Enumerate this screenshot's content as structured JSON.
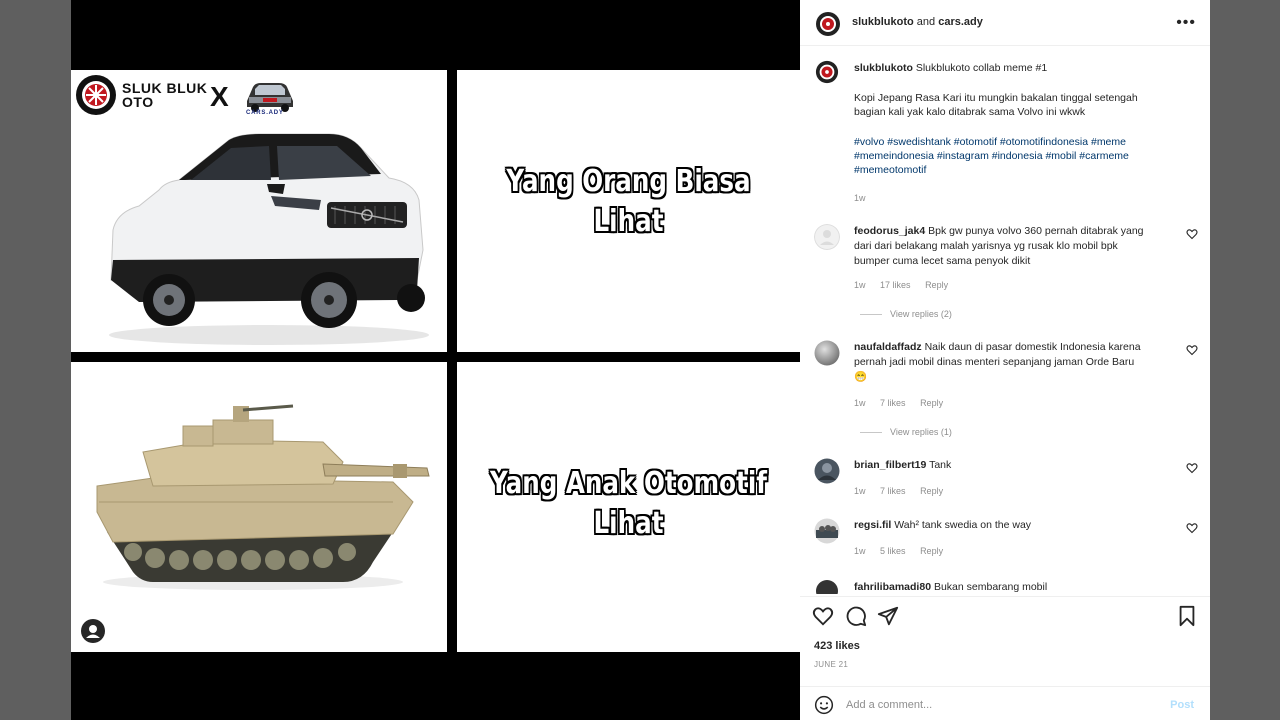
{
  "header": {
    "user1": "slukblukoto",
    "joiner": "and",
    "user2": "cars.ady",
    "more_icon": "more-horizontal-icon"
  },
  "meme": {
    "logo_text_line1": "SLUK BLUK",
    "logo_text_line2": "OTO",
    "collab_x": "X",
    "partner_logo_text": "CARS.ADY",
    "top_text_line1": "Yang Orang Biasa",
    "top_text_line2": "Lihat",
    "bottom_text_line1": "Yang Anak Otomotif",
    "bottom_text_line2": "Lihat"
  },
  "caption": {
    "username": "slukblukoto",
    "title": "Slukblukoto collab meme #1",
    "body_line1": "Kopi Jepang Rasa Kari itu mungkin bakalan tinggal setengah",
    "body_line2": "bagian kali yak kalo ditabrak sama Volvo ini wkwk",
    "tags_line1": "#volvo #swedishtank #otomotif #otomotifindonesia #meme",
    "tags_line2": "#memeindonesia #instagram #indonesia #mobil #carmeme",
    "tags_line3": "#memeotomotif",
    "time": "1w"
  },
  "comments": [
    {
      "username": "feodorus_jak4",
      "text_line1": "Bpk gw punya volvo 360 pernah ditabrak yang",
      "text_line2": "dari dari belakang malah yarisnya yg rusak klo mobil bpk",
      "text_line3": "bumper cuma lecet sama penyok dikit",
      "time": "1w",
      "likes": "17 likes",
      "reply": "Reply",
      "view_replies": "View replies (2)"
    },
    {
      "username": "naufaldaffadz",
      "text_line1": "Naik daun di pasar domestik Indonesia karena",
      "text_line2": "pernah jadi mobil dinas menteri sepanjang jaman Orde Baru",
      "text_line3": "😁",
      "time": "1w",
      "likes": "7 likes",
      "reply": "Reply",
      "view_replies": "View replies (1)"
    },
    {
      "username": "brian_filbert19",
      "text_line1": "Tank",
      "time": "1w",
      "likes": "7 likes",
      "reply": "Reply"
    },
    {
      "username": "regsi.fil",
      "text_line1": "Wah² tank swedia on the way",
      "time": "1w",
      "likes": "5 likes",
      "reply": "Reply"
    },
    {
      "username": "fahrilibamadi80",
      "text_line1": "Bukan sembarang mobil"
    }
  ],
  "footer": {
    "likes": "423 likes",
    "date": "JUNE 21",
    "comment_placeholder": "Add a comment...",
    "post_label": "Post"
  },
  "colors": {
    "link_blue": "#00376b",
    "muted": "#8e8e8e",
    "post_disabled": "#b2dffc"
  }
}
